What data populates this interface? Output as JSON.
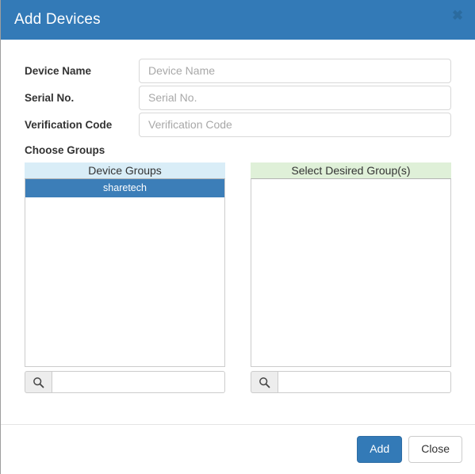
{
  "dialog": {
    "title": "Add Devices",
    "close_icon": "close-icon",
    "close_glyph": "✖"
  },
  "form": {
    "fields": [
      {
        "label": "Device Name",
        "value": "",
        "placeholder": "Device Name"
      },
      {
        "label": "Serial No.",
        "value": "",
        "placeholder": "Serial No."
      },
      {
        "label": "Verification Code",
        "value": "",
        "placeholder": "Verification Code"
      }
    ],
    "choose_groups_label": "Choose Groups"
  },
  "group_picker": {
    "available": {
      "header": "Device Groups",
      "items": [
        {
          "label": "sharetech",
          "selected": true
        }
      ],
      "search": {
        "value": "",
        "placeholder": "",
        "icon": "search-icon"
      }
    },
    "selected": {
      "header": "Select Desired Group(s)",
      "items": [],
      "search": {
        "value": "",
        "placeholder": "",
        "icon": "search-icon"
      }
    }
  },
  "footer": {
    "add_label": "Add",
    "close_label": "Close"
  },
  "colors": {
    "header_blue": "#337ab7",
    "available_header_bg": "#d9edf7",
    "selected_header_bg": "#dff0d8",
    "item_selected_bg": "#3c7eb8",
    "primary_button_bg": "#337ab7"
  }
}
